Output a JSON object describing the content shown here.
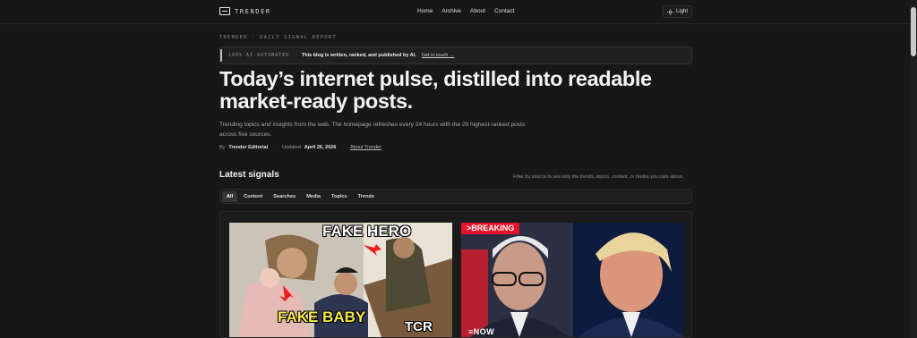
{
  "brand": {
    "name": "TRENDER"
  },
  "nav": {
    "items": [
      "Home",
      "Archive",
      "About",
      "Contact"
    ]
  },
  "theme_toggle": {
    "label": "Light"
  },
  "hero": {
    "kicker": "TRENDER · DAILY SIGNAL REPORT",
    "banner": {
      "tag": "100% AI-AUTOMATED",
      "text": "This blog is written, ranked, and published by AI.",
      "link": "Get in touch →"
    },
    "headline": "Today’s internet pulse, distilled into readable market-ready posts.",
    "lede": "Trending topics and insights from the web. The homepage refreshes every 24 hours with the 29 highest-ranked posts across five sources.",
    "byline": {
      "by_label": "By",
      "author": "Trender Editorial",
      "updated_label": "Updated",
      "date": "April 26, 2026",
      "about_link": "About Trender"
    }
  },
  "latest": {
    "title": "Latest signals",
    "hint": "Filter by source to see only the trends, topics, content, or media you care about.",
    "filters": [
      "All",
      "Content",
      "Searches",
      "Media",
      "Topics",
      "Trends"
    ],
    "active_filter": "All"
  },
  "cards": [
    {
      "labels": [
        "FAKE HERO",
        "FAKE BABY",
        "TCR"
      ]
    },
    {
      "badge": "BREAKING",
      "logo": "NOW"
    }
  ]
}
